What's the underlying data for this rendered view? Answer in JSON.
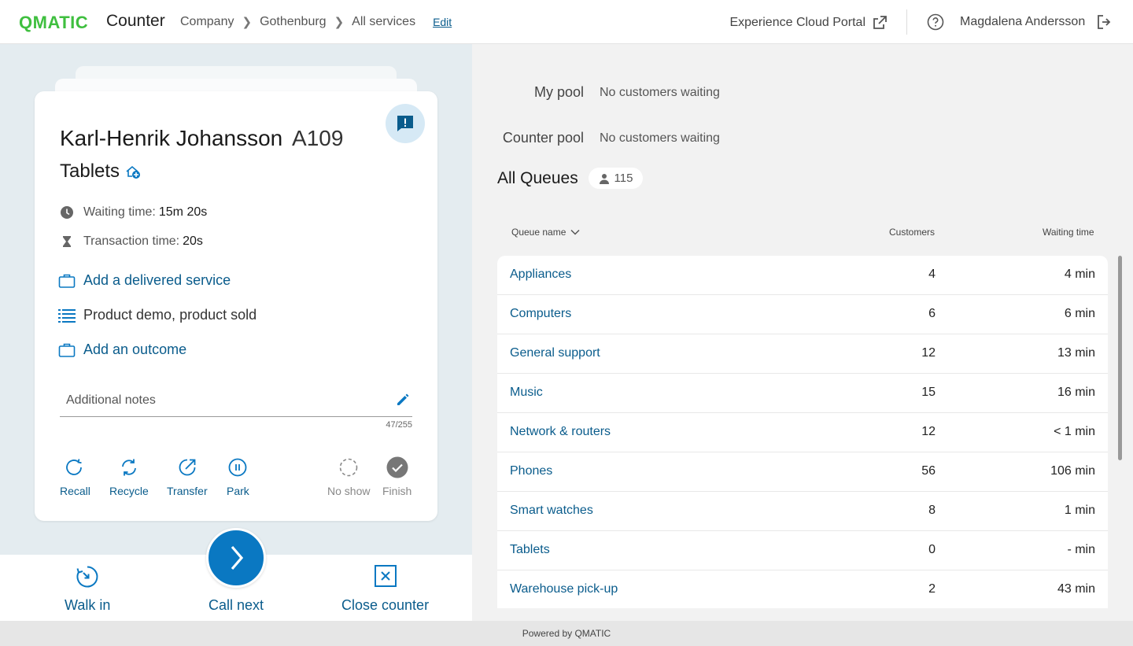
{
  "header": {
    "logo": "QMATIC",
    "app_title": "Counter",
    "breadcrumbs": [
      "Company",
      "Gothenburg",
      "All services"
    ],
    "edit_label": "Edit",
    "portal_label": "Experience Cloud Portal",
    "user_name": "Magdalena Andersson"
  },
  "customer": {
    "name": "Karl-Henrik Johansson",
    "ticket": "A109",
    "service": "Tablets",
    "waiting_label": "Waiting time:",
    "waiting_value": "15m 20s",
    "transaction_label": "Transaction time:",
    "transaction_value": "20s",
    "add_service_label": "Add a delivered service",
    "delivered": "Product demo, product sold",
    "add_outcome_label": "Add an outcome",
    "notes_placeholder": "Additional notes",
    "notes_counter": "47/255"
  },
  "actions": {
    "recall": "Recall",
    "recycle": "Recycle",
    "transfer": "Transfer",
    "park": "Park",
    "no_show": "No show",
    "finish": "Finish"
  },
  "bottom": {
    "walk_in": "Walk in",
    "call_next": "Call next",
    "close_counter": "Close counter"
  },
  "pools": {
    "my_pool_label": "My pool",
    "my_pool_value": "No customers waiting",
    "counter_pool_label": "Counter pool",
    "counter_pool_value": "No customers waiting"
  },
  "queues": {
    "title": "All Queues",
    "total": "115",
    "col_name": "Queue name",
    "col_customers": "Customers",
    "col_waiting": "Waiting time",
    "rows": [
      {
        "name": "Appliances",
        "customers": "4",
        "waiting": "4 min"
      },
      {
        "name": "Computers",
        "customers": "6",
        "waiting": "6 min"
      },
      {
        "name": "General support",
        "customers": "12",
        "waiting": "13 min"
      },
      {
        "name": "Music",
        "customers": "15",
        "waiting": "16 min"
      },
      {
        "name": "Network & routers",
        "customers": "12",
        "waiting": "< 1 min"
      },
      {
        "name": "Phones",
        "customers": "56",
        "waiting": "106 min"
      },
      {
        "name": "Smart watches",
        "customers": "8",
        "waiting": "1 min"
      },
      {
        "name": "Tablets",
        "customers": "0",
        "waiting": "- min"
      },
      {
        "name": "Warehouse pick-up",
        "customers": "2",
        "waiting": "43 min"
      }
    ]
  },
  "footer": "Powered by QMATIC",
  "colors": {
    "accent": "#0a78c2",
    "link": "#0a5c8c",
    "logo": "#3fbf3f"
  }
}
